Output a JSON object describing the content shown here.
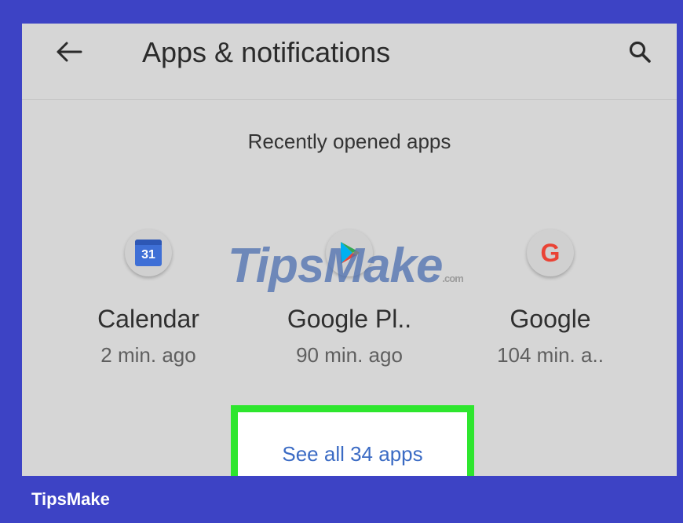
{
  "header": {
    "title": "Apps & notifications"
  },
  "section": {
    "title": "Recently opened apps"
  },
  "apps": [
    {
      "name": "Calendar",
      "time": "2 min. ago",
      "icon": "calendar-icon",
      "icon_text": "31"
    },
    {
      "name": "Google Pl..",
      "time": "90 min. ago",
      "icon": "google-play-icon"
    },
    {
      "name": "Google",
      "time": "104 min. a..",
      "icon": "google-icon",
      "icon_text": "G"
    }
  ],
  "see_all": {
    "label": "See all 34 apps"
  },
  "watermark": {
    "text": "TipsMake",
    "suffix": ".com"
  },
  "footer": {
    "brand": "TipsMake"
  },
  "colors": {
    "frame": "#3d43c5",
    "screen_bg": "#d6d6d6",
    "highlight": "#2ee62e",
    "link": "#3b6bc4"
  }
}
